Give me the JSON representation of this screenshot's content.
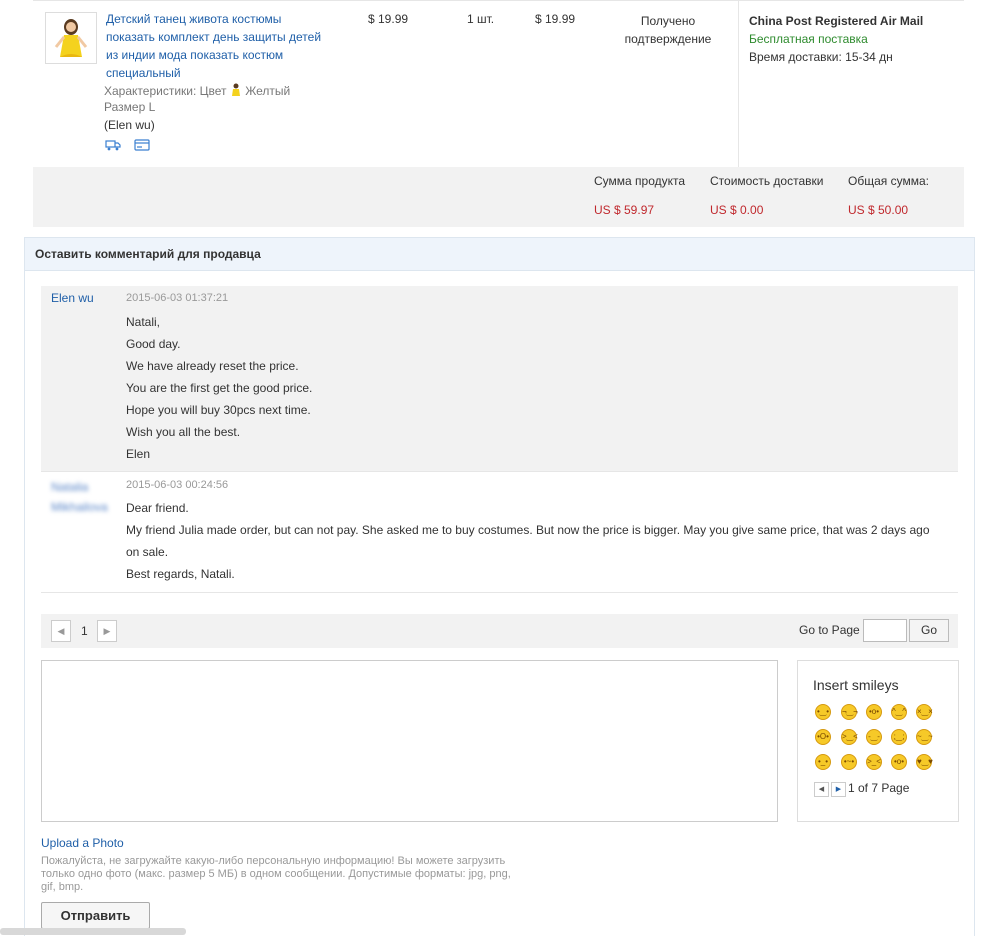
{
  "order": {
    "product_title_lines": [
      "Детский танец живота костюмы",
      "показать комплект день защиты детей",
      "из индии мода показать костюм",
      "специальный"
    ],
    "attr_label": "Характеристики: Цвет",
    "attr_color": "Желтый",
    "attr_size": "Размер L",
    "buyer": "(Elen wu)",
    "price": "$ 19.99",
    "qty": "1 шт.",
    "total": "$ 19.99",
    "status_lines": [
      "Получено",
      "подтверждение"
    ],
    "shipping_method": "China Post Registered Air Mail",
    "shipping_free": "Бесплатная поставка",
    "delivery_label": "Время доставки:",
    "delivery_time": "15-34 дн",
    "icons": [
      "truck-icon",
      "card-icon"
    ]
  },
  "summary": {
    "product_sum_label": "Сумма продукта",
    "product_sum": "US $ 59.97",
    "shipping_cost_label": "Стоимость доставки",
    "shipping_cost": "US $ 0.00",
    "total_label": "Общая сумма:",
    "total": "US $ 50.00"
  },
  "comments": {
    "header": "Оставить комментарий для продавца",
    "messages": [
      {
        "author": "Elen wu",
        "date": "2015-06-03 01:37:21",
        "lines": [
          "Natali,",
          "Good day.",
          "We have already reset the price.",
          "You are the first get the good price.",
          "Hope you will buy 30pcs next time.",
          "Wish you all the best.",
          "Elen"
        ]
      },
      {
        "author_lines": [
          "Natalia",
          "Mikhailova"
        ],
        "date": "2015-06-03 00:24:56",
        "lines": [
          "Dear friend.",
          "My friend Julia made order, but can not pay. She asked me to buy costumes. But now the price is bigger. May you give same price, that was 2 days ago",
          "on sale.",
          "Best regards, Natali."
        ]
      }
    ],
    "pager": {
      "prev": "◀",
      "page": "1",
      "next": "▶",
      "goto_label": "Go to Page",
      "go_button": "Go"
    },
    "smileys": {
      "title": "Insert smileys",
      "page_label": "1 of 7 Page"
    },
    "upload_link": "Upload a Photo",
    "upload_note": "Пожалуйста, не загружайте какую-либо персональную информацию! Вы можете загрузить только одно фото (макс. размер 5 МБ) в одном сообщении. Допустимые форматы: jpg, png, gif, bmp.",
    "send_button": "Отправить"
  }
}
